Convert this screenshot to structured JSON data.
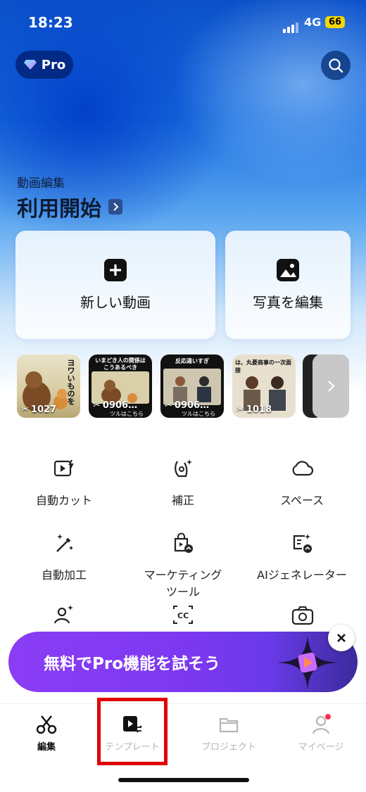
{
  "status": {
    "time": "18:23",
    "network": "4G",
    "battery": "66"
  },
  "header": {
    "pro_label": "Pro"
  },
  "hero": {
    "subtitle": "動画編集",
    "title": "利用開始"
  },
  "actions": {
    "new_video": "新しい動画",
    "edit_photo": "写真を編集"
  },
  "drafts": [
    {
      "label": "1027",
      "overlay": "ヨワいものを"
    },
    {
      "label": "0906…",
      "overlay": "いまどき人の関係は こうあるべき",
      "bottom": "ツルはこちら"
    },
    {
      "label": "0906…",
      "overlay": "反応違いすぎ",
      "bottom": "ツルはこちら"
    },
    {
      "label": "1018",
      "overlay": "は、丸菱商事の一次面接"
    },
    {
      "label": "",
      "overlay": ""
    }
  ],
  "tools": [
    {
      "label": "自動カット",
      "icon": "auto-cut-icon"
    },
    {
      "label": "補正",
      "icon": "retouch-icon"
    },
    {
      "label": "スペース",
      "icon": "cloud-icon"
    },
    {
      "label": "自動加工",
      "icon": "magic-wand-icon"
    },
    {
      "label": "マーケティング\nツール",
      "icon": "marketing-bag-icon"
    },
    {
      "label": "AIジェネレーター",
      "icon": "ai-generator-icon"
    }
  ],
  "promo": {
    "text": "無料でPro機能を試そう"
  },
  "nav": {
    "edit": "編集",
    "template": "テンプレート",
    "project": "プロジェクト",
    "mypage": "マイページ"
  },
  "colors": {
    "accent_red": "#e0000a",
    "promo_purple": "#8a3df5",
    "hero_blue": "#0a4fc9"
  }
}
